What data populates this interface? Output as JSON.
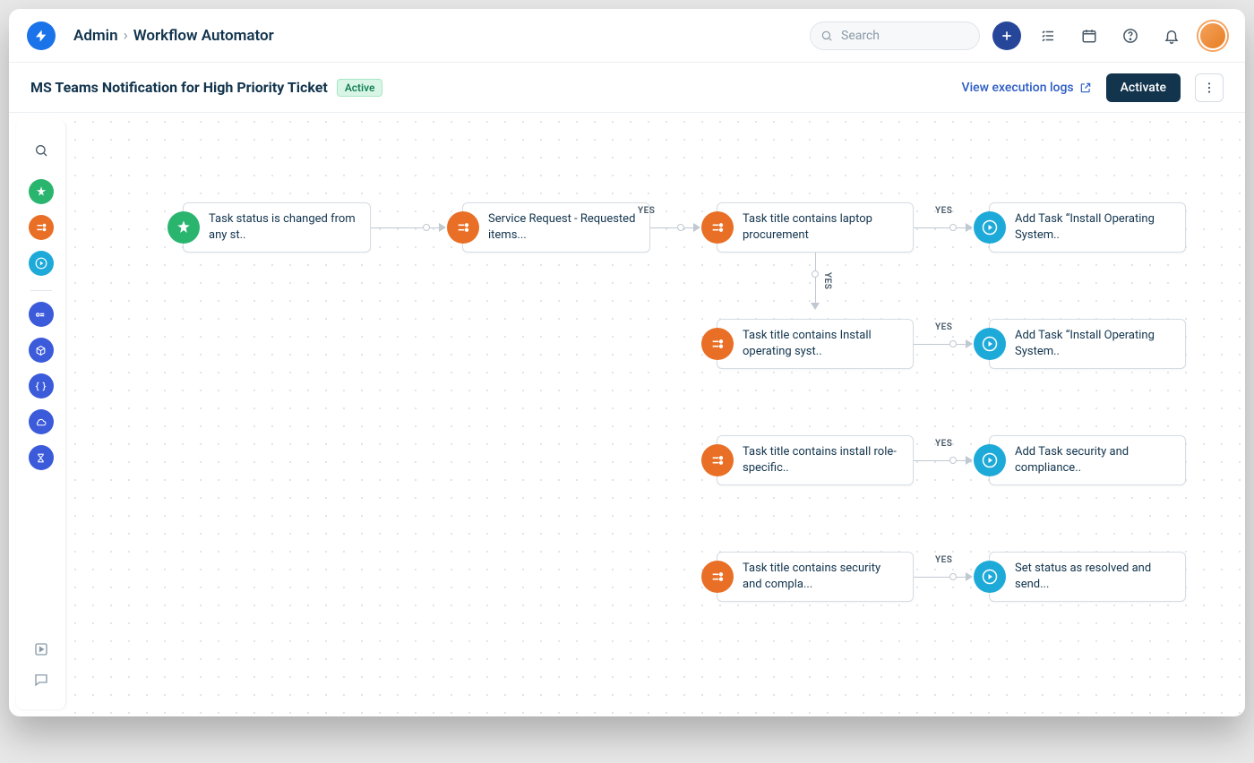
{
  "header": {
    "breadcrumb": [
      "Admin",
      "Workflow Automator"
    ],
    "search_placeholder": "Search"
  },
  "subheader": {
    "title": "MS Teams Notification for High Priority Ticket",
    "status_badge": "Active",
    "logs_link": "View execution logs",
    "activate_label": "Activate"
  },
  "workflow": {
    "trigger": {
      "text": "Task status is changed from any st.."
    },
    "c1": {
      "text": "Service Request - Requested items..."
    },
    "c2": {
      "text": "Task title contains laptop procurement"
    },
    "a1": {
      "text": "Add Task “Install Operating System.."
    },
    "c3": {
      "text": "Task title contains Install operating syst.."
    },
    "a2": {
      "text": "Add Task “Install Operating System.."
    },
    "c4": {
      "text": "Task title contains install role-specific.."
    },
    "a3": {
      "text": "Add Task security and compliance.."
    },
    "c5": {
      "text": "Task title contains security and compla..."
    },
    "a4": {
      "text": "Set status as resolved and send..."
    },
    "yes_label": "YES"
  }
}
